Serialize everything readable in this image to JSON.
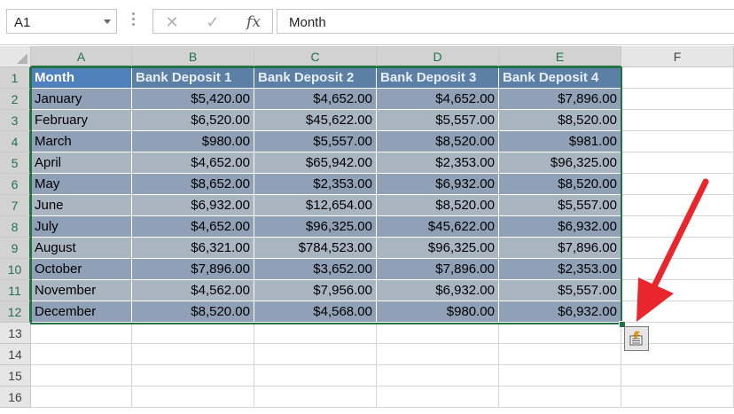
{
  "formula_bar": {
    "name_box": "A1",
    "cancel_icon": "close-icon",
    "enter_icon": "check-icon",
    "fx_label": "fx",
    "formula_value": "Month"
  },
  "columns": [
    "A",
    "B",
    "C",
    "D",
    "E",
    "F"
  ],
  "rows": [
    "1",
    "2",
    "3",
    "4",
    "5",
    "6",
    "7",
    "8",
    "9",
    "10",
    "11",
    "12",
    "13",
    "14",
    "15",
    "16"
  ],
  "table": {
    "headers": [
      "Month",
      "Bank Deposit 1",
      "Bank Deposit 2",
      "Bank Deposit 3",
      "Bank Deposit 4"
    ],
    "rows": [
      [
        "January",
        "$5,420.00",
        "$4,652.00",
        "$4,652.00",
        "$7,896.00"
      ],
      [
        "February",
        "$6,520.00",
        "$45,622.00",
        "$5,557.00",
        "$8,520.00"
      ],
      [
        "March",
        "$980.00",
        "$5,557.00",
        "$8,520.00",
        "$981.00"
      ],
      [
        "April",
        "$4,652.00",
        "$65,942.00",
        "$2,353.00",
        "$96,325.00"
      ],
      [
        "May",
        "$8,652.00",
        "$2,353.00",
        "$6,932.00",
        "$8,520.00"
      ],
      [
        "June",
        "$6,932.00",
        "$12,654.00",
        "$8,520.00",
        "$5,557.00"
      ],
      [
        "July",
        "$4,652.00",
        "$96,325.00",
        "$45,622.00",
        "$6,932.00"
      ],
      [
        "August",
        "$6,321.00",
        "$784,523.00",
        "$96,325.00",
        "$7,896.00"
      ],
      [
        "October",
        "$7,896.00",
        "$3,652.00",
        "$7,896.00",
        "$2,353.00"
      ],
      [
        "November",
        "$4,562.00",
        "$7,956.00",
        "$6,932.00",
        "$5,557.00"
      ],
      [
        "December",
        "$8,520.00",
        "$4,568.00",
        "$980.00",
        "$6,932.00"
      ]
    ]
  },
  "quick_analysis": {
    "icon": "quick-analysis-icon"
  },
  "annotation": {
    "icon": "red-arrow-icon",
    "color": "#e8262b"
  },
  "colors": {
    "accent_green": "#217346",
    "header_blue": "#4f81bd",
    "band_dark": "#8fa0b7",
    "band_light": "#aab5c2"
  }
}
